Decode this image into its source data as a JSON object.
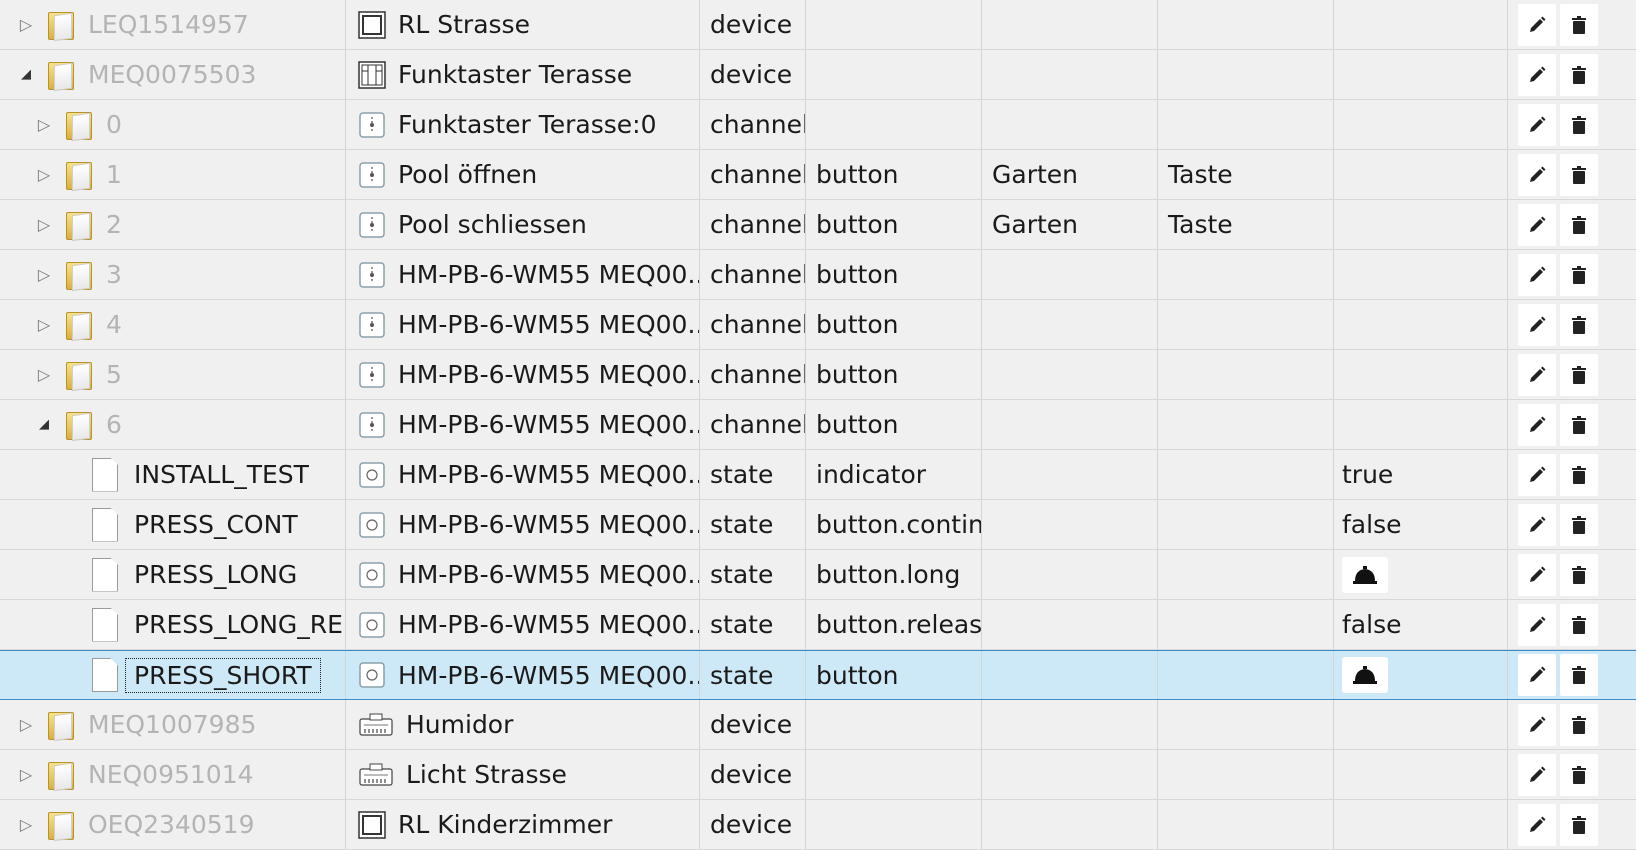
{
  "tree": {
    "rows": [
      {
        "level": 0,
        "toggle": "collapsed",
        "icon": "folder",
        "id": "LEQ1514957",
        "name": "RL Strasse",
        "name_icon": "blind-actuator-icon",
        "type": "device",
        "role": "",
        "room": "",
        "function": "",
        "value": ""
      },
      {
        "level": 0,
        "toggle": "expanded",
        "icon": "folder",
        "id": "MEQ0075503",
        "name": "Funktaster Terasse",
        "name_icon": "six-button-switch-icon",
        "type": "device",
        "role": "",
        "room": "",
        "function": "",
        "value": ""
      },
      {
        "level": 1,
        "toggle": "collapsed",
        "icon": "folder",
        "id": "0",
        "name": "Funktaster Terasse:0",
        "name_icon": "channel-icon",
        "type": "channel",
        "role": "",
        "room": "",
        "function": "",
        "value": ""
      },
      {
        "level": 1,
        "toggle": "collapsed",
        "icon": "folder",
        "id": "1",
        "name": "Pool öffnen",
        "name_icon": "channel-icon",
        "type": "channel",
        "role": "button",
        "room": "Garten",
        "function": "Taste",
        "value": ""
      },
      {
        "level": 1,
        "toggle": "collapsed",
        "icon": "folder",
        "id": "2",
        "name": "Pool schliessen",
        "name_icon": "channel-icon",
        "type": "channel",
        "role": "button",
        "room": "Garten",
        "function": "Taste",
        "value": ""
      },
      {
        "level": 1,
        "toggle": "collapsed",
        "icon": "folder",
        "id": "3",
        "name": "HM-PB-6-WM55 MEQ00...",
        "name_icon": "channel-icon",
        "type": "channel",
        "role": "button",
        "room": "",
        "function": "",
        "value": ""
      },
      {
        "level": 1,
        "toggle": "collapsed",
        "icon": "folder",
        "id": "4",
        "name": "HM-PB-6-WM55 MEQ00...",
        "name_icon": "channel-icon",
        "type": "channel",
        "role": "button",
        "room": "",
        "function": "",
        "value": ""
      },
      {
        "level": 1,
        "toggle": "collapsed",
        "icon": "folder",
        "id": "5",
        "name": "HM-PB-6-WM55 MEQ00...",
        "name_icon": "channel-icon",
        "type": "channel",
        "role": "button",
        "room": "",
        "function": "",
        "value": ""
      },
      {
        "level": 1,
        "toggle": "expanded",
        "icon": "folder",
        "id": "6",
        "name": "HM-PB-6-WM55 MEQ00...",
        "name_icon": "channel-icon",
        "type": "channel",
        "role": "button",
        "room": "",
        "function": "",
        "value": ""
      },
      {
        "level": 2,
        "toggle": "none",
        "icon": "file",
        "id": "INSTALL_TEST",
        "name": "HM-PB-6-WM55 MEQ00...",
        "name_icon": "state-icon",
        "type": "state",
        "role": "indicator",
        "room": "",
        "function": "",
        "value": "true"
      },
      {
        "level": 2,
        "toggle": "none",
        "icon": "file",
        "id": "PRESS_CONT",
        "name": "HM-PB-6-WM55 MEQ00...",
        "name_icon": "state-icon",
        "type": "state",
        "role": "button.continu",
        "room": "",
        "function": "",
        "value": "false"
      },
      {
        "level": 2,
        "toggle": "none",
        "icon": "file",
        "id": "PRESS_LONG",
        "name": "HM-PB-6-WM55 MEQ00...",
        "name_icon": "state-icon",
        "type": "state",
        "role": "button.long",
        "room": "",
        "function": "",
        "value": "",
        "value_button": "bell-icon"
      },
      {
        "level": 2,
        "toggle": "none",
        "icon": "file",
        "id": "PRESS_LONG_REL",
        "name": "HM-PB-6-WM55 MEQ00...",
        "name_icon": "state-icon",
        "type": "state",
        "role": "button.release",
        "room": "",
        "function": "",
        "value": "false"
      },
      {
        "level": 2,
        "toggle": "none",
        "icon": "file",
        "id": "PRESS_SHORT",
        "name": "HM-PB-6-WM55 MEQ00...",
        "name_icon": "state-icon",
        "type": "state",
        "role": "button",
        "room": "",
        "function": "",
        "value": "",
        "value_button": "bell-icon",
        "selected": true
      },
      {
        "level": 0,
        "toggle": "collapsed",
        "icon": "folder",
        "id": "MEQ1007985",
        "name": "Humidor",
        "name_icon": "climate-sensor-icon",
        "type": "device",
        "role": "",
        "room": "",
        "function": "",
        "value": ""
      },
      {
        "level": 0,
        "toggle": "collapsed",
        "icon": "folder",
        "id": "NEQ0951014",
        "name": "Licht Strasse",
        "name_icon": "climate-sensor-icon",
        "type": "device",
        "role": "",
        "room": "",
        "function": "",
        "value": ""
      },
      {
        "level": 0,
        "toggle": "collapsed",
        "icon": "folder",
        "id": "OEQ2340519",
        "name": "RL Kinderzimmer",
        "name_icon": "blind-actuator-icon",
        "type": "device",
        "role": "",
        "room": "",
        "function": "",
        "value": ""
      }
    ],
    "actions": {
      "edit_icon": "pencil-icon",
      "delete_icon": "trash-icon"
    }
  },
  "colors": {
    "background": "#f0f0f0",
    "selected_row": "#cde8f6",
    "selected_border": "#3a8cc6",
    "muted_text": "#b4b4b4"
  }
}
